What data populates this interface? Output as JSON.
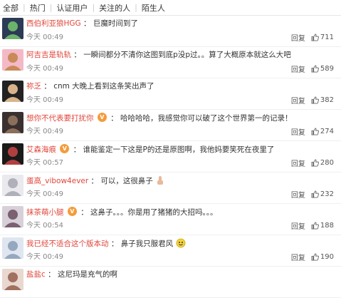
{
  "filter": {
    "items": [
      "全部",
      "热门",
      "认证用户",
      "关注的人",
      "陌生人"
    ]
  },
  "reply_label": "回复",
  "comments": [
    {
      "user": "西伯利亚狼HGG",
      "text": "巨魔时间到了",
      "time": "今天 00:49",
      "likes": "711",
      "badge": "",
      "emoji": "",
      "avatar_colors": [
        "#2b3a55",
        "#6bb36b"
      ]
    },
    {
      "user": "阿吉吉是轨轨",
      "text": "一瞬间都分不清你这图到底p没p过。。算了大概原本就这么大吧",
      "time": "今天 00:49",
      "likes": "589",
      "badge": "",
      "emoji": "",
      "avatar_colors": [
        "#f4b9c6",
        "#c98a5a"
      ]
    },
    {
      "user": "祢乏",
      "text": "cnm 大晚上看到这条笑出声了",
      "time": "今天 00:49",
      "likes": "382",
      "badge": "",
      "emoji": "",
      "avatar_colors": [
        "#222222",
        "#d9b48a"
      ]
    },
    {
      "user": "想你不代表要打扰你",
      "text": "哈哈哈哈，我感觉你可以破了这个世界第一的记录！",
      "time": "今天 00:49",
      "likes": "274",
      "badge": "vip",
      "emoji": "",
      "avatar_colors": [
        "#3a3030",
        "#8a6f5a"
      ]
    },
    {
      "user": "艾森海痕",
      "text": "谁能鉴定一下这是P的还是原图啊，我他妈要笑死在夜里了",
      "time": "今天 00:57",
      "likes": "280",
      "badge": "vip",
      "emoji": "",
      "avatar_colors": [
        "#1a1a1a",
        "#b04040"
      ]
    },
    {
      "user": "蛋高_vibow4ever",
      "text": "可以，这很鼻子",
      "time": "今天 00:49",
      "likes": "232",
      "badge": "",
      "emoji": "thumb",
      "avatar_colors": [
        "#e9e9ee",
        "#b0b0bb"
      ]
    },
    {
      "user": "抹茶萌小腿",
      "text": "这鼻子。。。你是用了猪猪的大招吗。。。",
      "time": "今天 00:54",
      "likes": "188",
      "badge": "vip",
      "emoji": "",
      "avatar_colors": [
        "#d8d0d8",
        "#7a6070"
      ]
    },
    {
      "user": "我已经不适合这个版本动",
      "text": "鼻子我只服君风",
      "time": "今天 00:49",
      "likes": "190",
      "badge": "",
      "emoji": "smile",
      "avatar_colors": [
        "#dfe6ef",
        "#96a8c0"
      ]
    },
    {
      "user": "盐盐c",
      "text": "这尼玛是充气的啊",
      "time": "",
      "likes": "",
      "badge": "",
      "emoji": "",
      "avatar_colors": [
        "#e8d8cf",
        "#a07060"
      ]
    }
  ]
}
